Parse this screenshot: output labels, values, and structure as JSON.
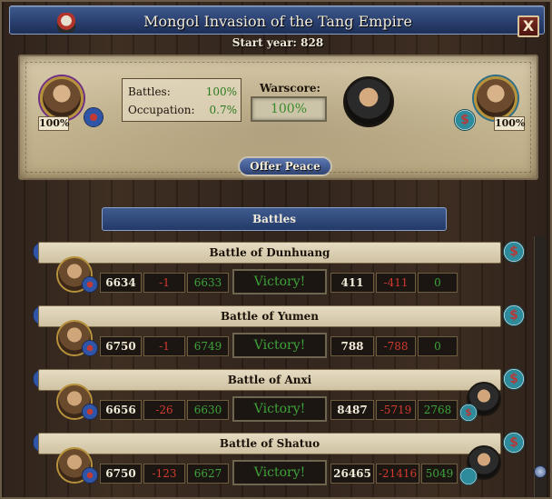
{
  "window": {
    "title": "Mongol Invasion of the Tang Empire",
    "start_year": "Start year: 828",
    "close_label": "X"
  },
  "summary": {
    "left_percent": "100%",
    "right_percent": "100%",
    "battles_label": "Battles:",
    "battles_value": "100%",
    "occupation_label": "Occupation:",
    "occupation_value": "0.7%",
    "warscore_label": "Warscore:",
    "warscore_value": "100%",
    "offer_peace_label": "Offer Peace"
  },
  "battles_header": "Battles",
  "money_glyph": "$",
  "battles": [
    {
      "name": "Battle of Dunhuang",
      "a_start": "6634",
      "a_loss": "-1",
      "a_remain": "6633",
      "result": "Victory!",
      "d_start": "411",
      "d_loss": "-411",
      "d_remain": "0"
    },
    {
      "name": "Battle of Yumen",
      "a_start": "6750",
      "a_loss": "-1",
      "a_remain": "6749",
      "result": "Victory!",
      "d_start": "788",
      "d_loss": "-788",
      "d_remain": "0"
    },
    {
      "name": "Battle of Anxi",
      "a_start": "6656",
      "a_loss": "-26",
      "a_remain": "6630",
      "result": "Victory!",
      "d_start": "8487",
      "d_loss": "-5719",
      "d_remain": "2768"
    },
    {
      "name": "Battle of Shatuo",
      "a_start": "6750",
      "a_loss": "-123",
      "a_remain": "6627",
      "result": "Victory!",
      "d_start": "26465",
      "d_loss": "-21416",
      "d_remain": "5049"
    }
  ],
  "colors": {
    "title_blue": "#2a4070",
    "parchment": "#c8b995",
    "positive_green": "#3ea23a",
    "loss_red": "#d33a30"
  }
}
